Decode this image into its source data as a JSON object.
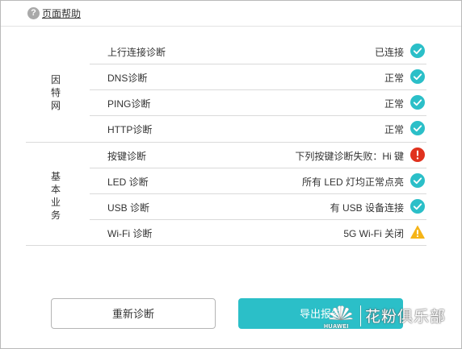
{
  "help": {
    "icon_glyph": "?",
    "link_label": "页面帮助"
  },
  "groups": {
    "internet": {
      "chars": [
        "因",
        "特",
        "网"
      ]
    },
    "basic": {
      "chars": [
        "基",
        "本",
        "业",
        "务"
      ]
    }
  },
  "rows": [
    {
      "name": "上行连接诊断",
      "status": "已连接",
      "icon": "check-circle-icon"
    },
    {
      "name": "DNS诊断",
      "status": "正常",
      "icon": "check-circle-icon"
    },
    {
      "name": "PING诊断",
      "status": "正常",
      "icon": "check-circle-icon"
    },
    {
      "name": "HTTP诊断",
      "status": "正常",
      "icon": "check-circle-icon"
    },
    {
      "name": "按键诊断",
      "status": "下列按键诊断失败：Hi 键",
      "icon": "error-circle-icon"
    },
    {
      "name": "LED 诊断",
      "status": "所有 LED 灯均正常点亮",
      "icon": "check-circle-icon"
    },
    {
      "name": "USB 诊断",
      "status": "有 USB 设备连接",
      "icon": "check-circle-icon"
    },
    {
      "name": "Wi-Fi 诊断",
      "status": "5G Wi-Fi 关闭",
      "icon": "warning-triangle-icon"
    }
  ],
  "buttons": {
    "retest_label": "重新诊断",
    "export_label": "导出报告"
  },
  "watermark": {
    "brand": "HUAWEI",
    "text": "花粉俱乐部"
  },
  "colors": {
    "ok": "#2bbfc8",
    "error": "#e0321e",
    "warning": "#f5b417",
    "accent": "#2bbfc8"
  }
}
